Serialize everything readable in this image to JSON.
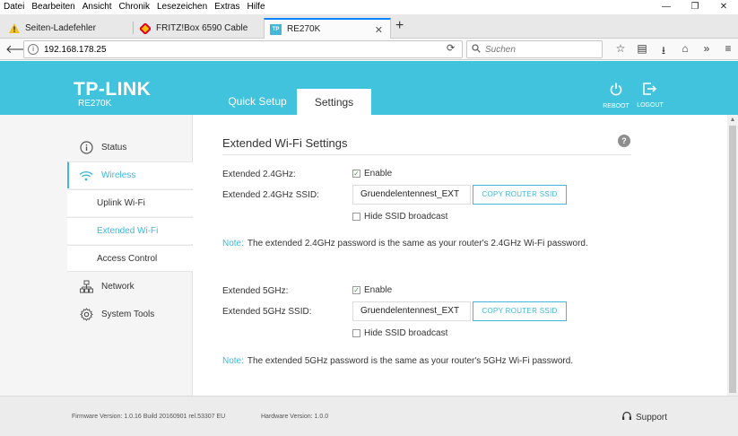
{
  "menubar": {
    "items": [
      "Datei",
      "Bearbeiten",
      "Ansicht",
      "Chronik",
      "Lesezeichen",
      "Extras",
      "Hilfe"
    ]
  },
  "window_controls": {
    "minimize": "—",
    "restore": "❐",
    "close": "✕"
  },
  "tabs": [
    {
      "label": "Seiten-Ladefehler",
      "icon": "warning-icon",
      "active": false
    },
    {
      "label": "FRITZ!Box 6590 Cable",
      "icon": "fritzbox-icon",
      "active": false
    },
    {
      "label": "RE270K",
      "icon": "tplink-favicon",
      "active": true
    }
  ],
  "new_tab": "+",
  "navbar": {
    "url": "192.168.178.25",
    "search_placeholder": "Suchen"
  },
  "header": {
    "logo": "TP-LINK",
    "model": "RE270K",
    "tabs": {
      "quick_setup": "Quick Setup",
      "settings": "Settings"
    },
    "reboot": "REBOOT",
    "logout": "LOGOUT"
  },
  "sidebar": {
    "status": "Status",
    "wireless": "Wireless",
    "uplink_wifi": "Uplink Wi-Fi",
    "extended_wifi": "Extended Wi-Fi",
    "access_control": "Access Control",
    "network": "Network",
    "system_tools": "System Tools"
  },
  "main": {
    "title": "Extended Wi-Fi Settings",
    "help": "?",
    "band24": {
      "enable_label": "Extended 2.4GHz:",
      "enable_text": "Enable",
      "enabled": true,
      "ssid_label": "Extended 2.4GHz SSID:",
      "ssid_value": "Gruendelentennest_EXT",
      "copy_button": "COPY ROUTER SSID",
      "hide_text": "Hide SSID broadcast",
      "hidden": false,
      "note_label": "Note:",
      "note_text": "The extended 2.4GHz password is the same as your router's 2.4GHz Wi-Fi password."
    },
    "band5": {
      "enable_label": "Extended 5GHz:",
      "enable_text": "Enable",
      "enabled": true,
      "ssid_label": "Extended 5GHz SSID:",
      "ssid_value": "Gruendelentennest_EXT",
      "copy_button": "COPY ROUTER SSID",
      "hide_text": "Hide SSID broadcast",
      "hidden": false,
      "note_label": "Note:",
      "note_text": "The extended 5GHz password is the same as your router's 5GHz Wi-Fi password."
    }
  },
  "footer": {
    "firmware": "Firmware Version: 1.0.16 Build 20160901 rel.53307 EU",
    "hardware": "Hardware Version: 1.0.0",
    "support": "Support"
  },
  "colors": {
    "header_bg": "#42c3dd",
    "accent": "#42b7d9",
    "sidebar_bg": "#f5f5f5",
    "footer_bg": "#ececec"
  }
}
